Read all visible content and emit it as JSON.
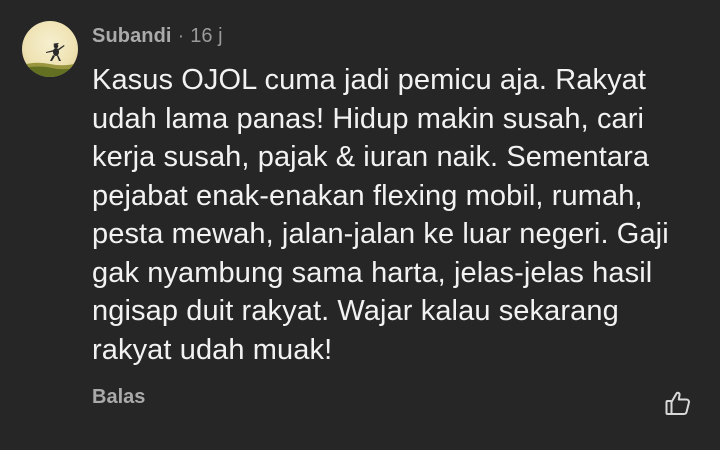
{
  "comment": {
    "author": "Subandi",
    "separator": "·",
    "time": "16 j",
    "avatar_icon": "avatar-photo",
    "text_lines": [
      "Kasus OJOL cuma jadi pemicu aja. Rakyat",
      "udah lama panas! Hidup makin susah, cari",
      "kerja susah, pajak & iuran naik. Sementara",
      "pejabat enak-enakan flexing mobil, rumah,",
      "pesta mewah, jalan-jalan ke luar negeri. Gaji",
      "gak nyambung sama harta, jelas-jelas hasil",
      "ngisap duit rakyat. Wajar kalau sekarang",
      "rakyat udah muak!"
    ],
    "reply_label": "Balas",
    "like_icon": "thumbs-up-icon"
  },
  "colors": {
    "background": "#262626",
    "text": "#f2f2f2",
    "muted": "#aaaaaa"
  }
}
